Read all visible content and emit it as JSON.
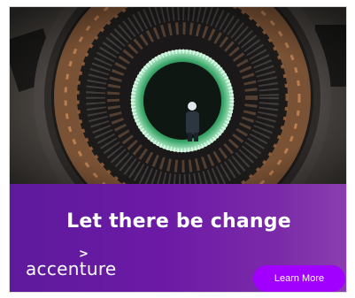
{
  "ad": {
    "headline": "Let there be change",
    "brand": {
      "name": "accenture",
      "mark": ">"
    },
    "cta_label": "Learn More",
    "colors": {
      "banner_start": "#5e1a9c",
      "banner_end": "#8a3fb0",
      "cta": "#a100ff",
      "text": "#ffffff"
    },
    "hero_image": "industrial-turbine-stator-photo"
  }
}
